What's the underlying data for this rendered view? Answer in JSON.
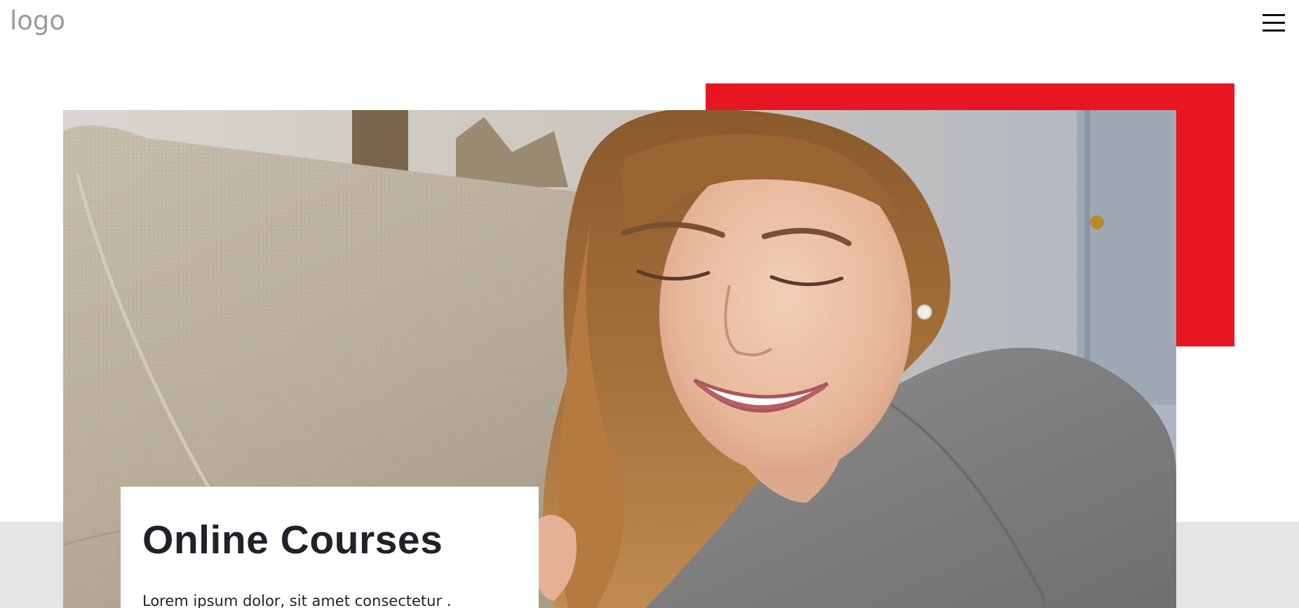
{
  "header": {
    "logo_text": "logo",
    "menu_icon": "hamburger-menu-icon"
  },
  "hero": {
    "image_subject": "smiling woman on couch",
    "card": {
      "title": "Online Courses",
      "body": "Lorem ipsum dolor, sit amet consectetur ."
    }
  },
  "colors": {
    "accent_red": "#e81623",
    "band_gray": "#e5e5e5",
    "logo_gray": "#9a9a9a",
    "text_dark": "#1f2229"
  }
}
